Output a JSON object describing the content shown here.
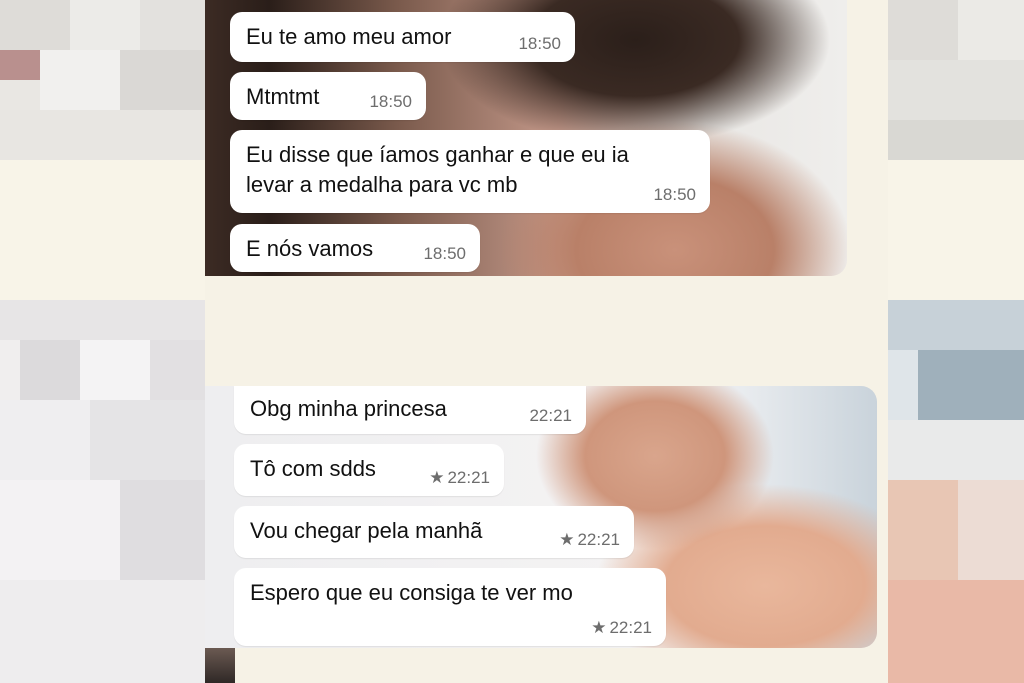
{
  "chat_top": {
    "messages": [
      {
        "text": "Eu te amo meu amor",
        "time": "18:50"
      },
      {
        "text": "Mtmtmt",
        "time": "18:50"
      },
      {
        "text": "Eu disse que íamos ganhar e que eu ia\nlevar a medalha para vc mb",
        "time": "18:50"
      },
      {
        "text": "E nós vamos",
        "time": "18:50"
      }
    ]
  },
  "chat_bottom": {
    "messages": [
      {
        "text": "Obg minha princesa",
        "time": "22:21",
        "starred": false
      },
      {
        "text": "Tô com sdds",
        "time": "22:21",
        "starred": true
      },
      {
        "text": "Vou chegar pela manhã",
        "time": "22:21",
        "starred": true
      },
      {
        "text": "Espero que eu consiga te ver mo",
        "time": "22:21",
        "starred": true
      }
    ]
  },
  "icons": {
    "star": "★"
  },
  "colors": {
    "bubble": "#ffffff",
    "time": "#6d6d6d",
    "page": "#f6f2e6"
  }
}
